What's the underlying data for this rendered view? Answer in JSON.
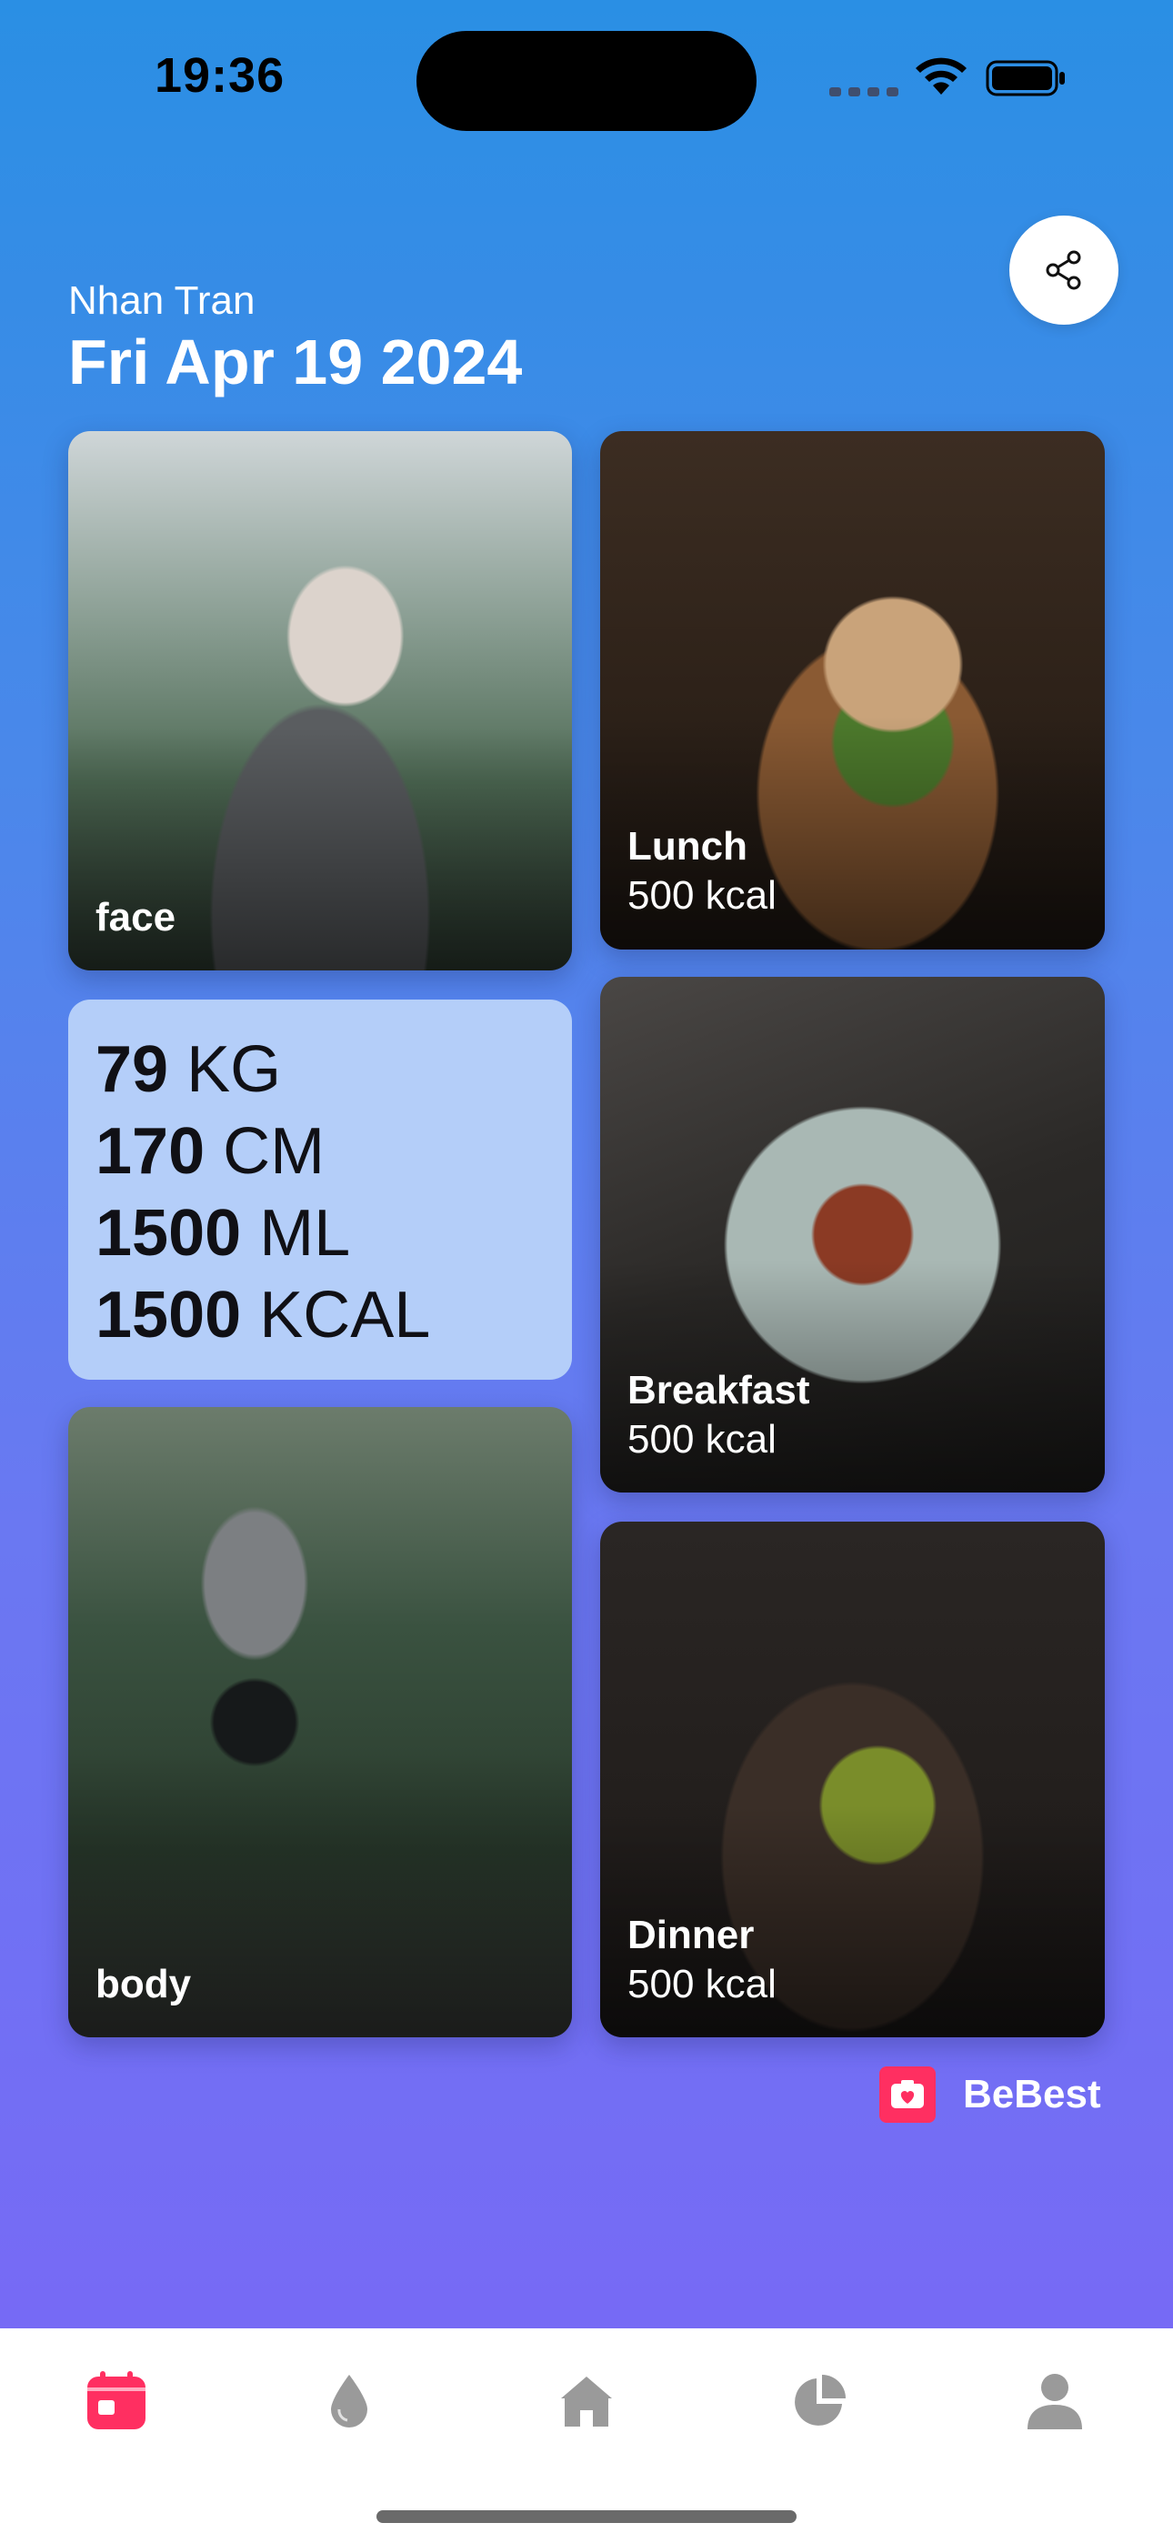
{
  "status_bar": {
    "time": "19:36"
  },
  "header": {
    "user_name": "Nhan Tran",
    "date": "Fri Apr 19 2024"
  },
  "cards": {
    "face": {
      "label": "face"
    },
    "body": {
      "label": "body"
    },
    "lunch": {
      "label": "Lunch",
      "kcal": "500 kcal"
    },
    "breakfast": {
      "label": "Breakfast",
      "kcal": "500 kcal"
    },
    "dinner": {
      "label": "Dinner",
      "kcal": "500 kcal"
    }
  },
  "stats": [
    {
      "value": "79",
      "unit": "KG"
    },
    {
      "value": "170",
      "unit": "CM"
    },
    {
      "value": "1500",
      "unit": "ML"
    },
    {
      "value": "1500",
      "unit": "KCAL"
    }
  ],
  "brand": {
    "name": "BeBest"
  },
  "tabbar": {
    "items": [
      {
        "icon": "calendar-icon",
        "active": true
      },
      {
        "icon": "water-drop-icon",
        "active": false
      },
      {
        "icon": "home-icon",
        "active": false
      },
      {
        "icon": "pie-chart-icon",
        "active": false
      },
      {
        "icon": "profile-icon",
        "active": false
      }
    ]
  },
  "colors": {
    "accent": "#ff2f61",
    "tab_inactive": "#9a9a9a",
    "stats_bg": "#b4cef9"
  }
}
